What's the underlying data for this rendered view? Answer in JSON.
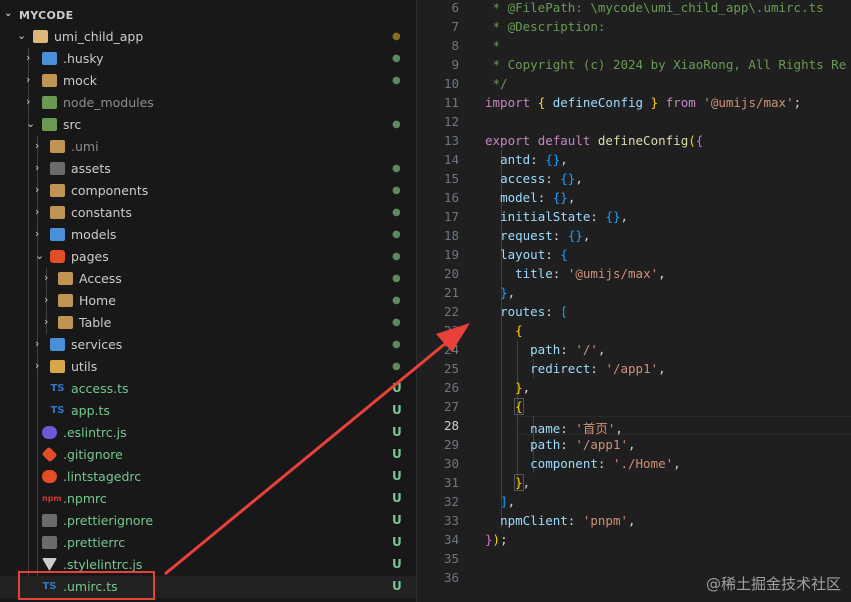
{
  "explorer": {
    "root_label": "MYCODE",
    "items": [
      {
        "name": "umi_child_app",
        "kind": "folder-open",
        "status": "dot"
      },
      {
        "name": ".husky",
        "kind": "folder",
        "status": "dot"
      },
      {
        "name": "mock",
        "kind": "folder",
        "status": "dot"
      },
      {
        "name": "node_modules",
        "kind": "folder",
        "status": ""
      },
      {
        "name": "src",
        "kind": "folder-open",
        "status": "dot"
      },
      {
        "name": ".umi",
        "kind": "folder",
        "status": ""
      },
      {
        "name": "assets",
        "kind": "folder",
        "status": "dot"
      },
      {
        "name": "components",
        "kind": "folder",
        "status": "dot"
      },
      {
        "name": "constants",
        "kind": "folder",
        "status": "dot"
      },
      {
        "name": "models",
        "kind": "folder",
        "status": "dot"
      },
      {
        "name": "pages",
        "kind": "folder-open",
        "status": "dot"
      },
      {
        "name": "Access",
        "kind": "folder",
        "status": "dot"
      },
      {
        "name": "Home",
        "kind": "folder",
        "status": "dot"
      },
      {
        "name": "Table",
        "kind": "folder",
        "status": "dot"
      },
      {
        "name": "services",
        "kind": "folder",
        "status": "dot"
      },
      {
        "name": "utils",
        "kind": "folder",
        "status": "dot"
      },
      {
        "name": "access.ts",
        "kind": "ts",
        "status": "U"
      },
      {
        "name": "app.ts",
        "kind": "ts",
        "status": "U"
      },
      {
        "name": ".eslintrc.js",
        "kind": "eslint",
        "status": "U"
      },
      {
        "name": ".gitignore",
        "kind": "git",
        "status": "U"
      },
      {
        "name": ".lintstagedrc",
        "kind": "lint",
        "status": "U"
      },
      {
        "name": ".npmrc",
        "kind": "npm",
        "status": "U"
      },
      {
        "name": ".prettierignore",
        "kind": "prettier",
        "status": "U"
      },
      {
        "name": ".prettierrc",
        "kind": "prettier",
        "status": "U"
      },
      {
        "name": ".stylelintrc.js",
        "kind": "stylelint",
        "status": "U"
      },
      {
        "name": ".umirc.ts",
        "kind": "ts",
        "status": "U"
      }
    ],
    "ts_label": "TS",
    "npm_label": "npm"
  },
  "editor": {
    "line_numbers": [
      "6",
      "7",
      "8",
      "9",
      "10",
      "11",
      "12",
      "13",
      "14",
      "15",
      "16",
      "17",
      "18",
      "19",
      "20",
      "21",
      "22",
      "23",
      "24",
      "25",
      "26",
      "27",
      "28",
      "29",
      "30",
      "31",
      "32",
      "33",
      "34",
      "35",
      "36"
    ],
    "lines": {
      "l6": " * @FilePath: \\mycode\\umi_child_app\\.umirc.ts",
      "l7": " * @Description:",
      "l8": " *",
      "l9": " * Copyright (c) 2024 by XiaoRong, All Rights Re",
      "l10": " */",
      "import_kw": "import",
      "import_name": "defineConfig",
      "from_kw": "from",
      "import_src": "'@umijs/max'",
      "export_kw": "export",
      "default_kw": "default",
      "define_fn": "defineConfig",
      "antd": "antd",
      "access": "access",
      "model": "model",
      "initialState": "initialState",
      "request": "request",
      "layout": "layout",
      "title": "title",
      "title_val": "'@umijs/max'",
      "routes": "routes",
      "path": "path",
      "path_val1": "'/'",
      "redirect": "redirect",
      "redirect_val": "'/app1'",
      "name": "name",
      "name_val": "'首页'",
      "path_val2": "'/app1'",
      "component": "component",
      "component_val": "'./Home'",
      "npmClient": "npmClient",
      "npm_val": "'pnpm'"
    }
  },
  "watermark": "@稀土掘金技术社区",
  "colors": {
    "arrow": "#e8413a",
    "highlight": "#e8413a",
    "untracked": "#73c991"
  }
}
